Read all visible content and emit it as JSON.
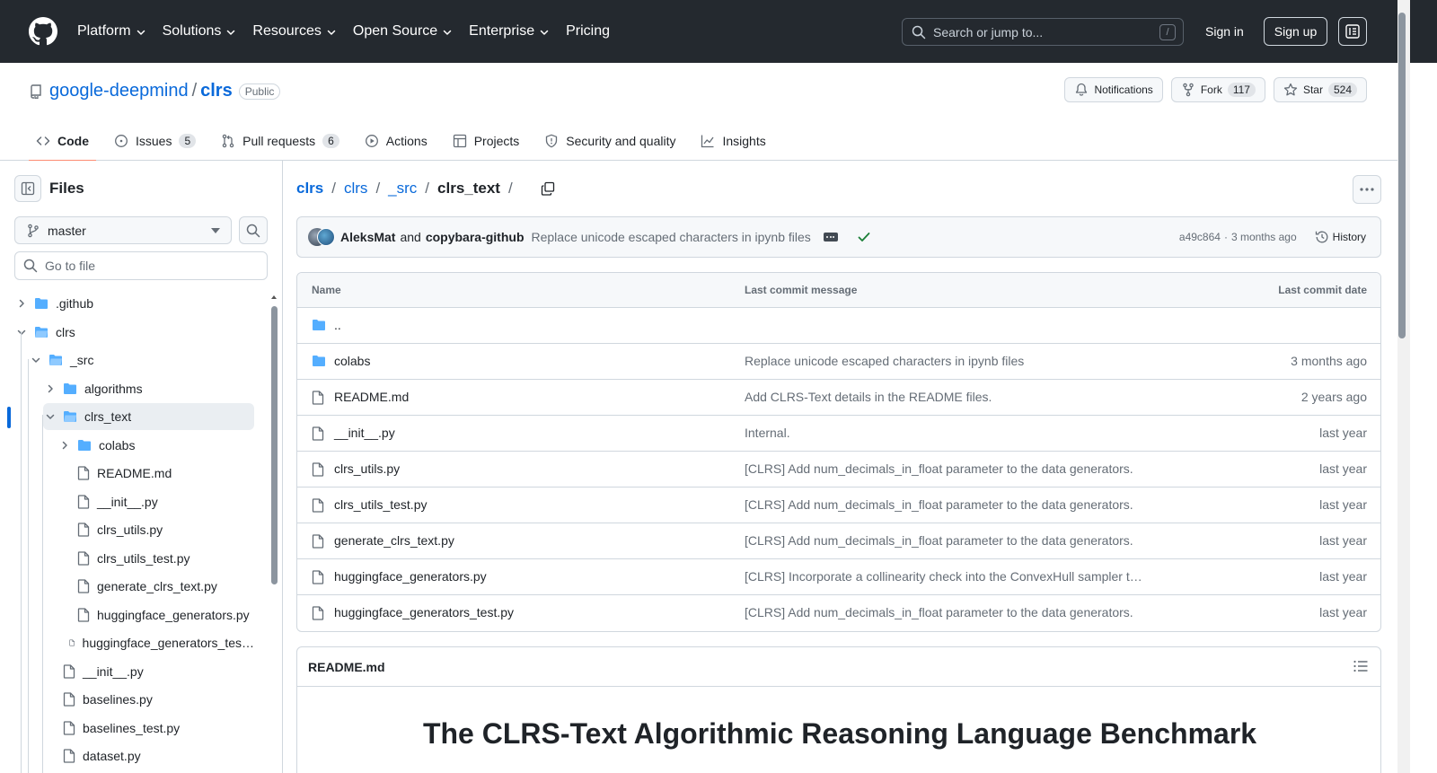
{
  "header": {
    "nav": [
      "Platform",
      "Solutions",
      "Resources",
      "Open Source",
      "Enterprise",
      "Pricing"
    ],
    "nav_has_dropdown": [
      true,
      true,
      true,
      true,
      true,
      false
    ],
    "search_placeholder": "Search or jump to...",
    "search_key": "/",
    "sign_in": "Sign in",
    "sign_up": "Sign up"
  },
  "repo": {
    "owner": "google-deepmind",
    "name": "clrs",
    "visibility": "Public",
    "notifications": "Notifications",
    "fork_label": "Fork",
    "fork_count": "117",
    "star_label": "Star",
    "star_count": "524"
  },
  "tabs": [
    {
      "label": "Code",
      "icon": "code-icon",
      "count": null,
      "active": true
    },
    {
      "label": "Issues",
      "icon": "issue-icon",
      "count": "5",
      "active": false
    },
    {
      "label": "Pull requests",
      "icon": "pull-request-icon",
      "count": "6",
      "active": false
    },
    {
      "label": "Actions",
      "icon": "play-icon",
      "count": null,
      "active": false
    },
    {
      "label": "Projects",
      "icon": "table-icon",
      "count": null,
      "active": false
    },
    {
      "label": "Security and quality",
      "icon": "shield-icon",
      "count": null,
      "active": false
    },
    {
      "label": "Insights",
      "icon": "graph-icon",
      "count": null,
      "active": false
    }
  ],
  "sidebar": {
    "title": "Files",
    "branch": "master",
    "goto_placeholder": "Go to file",
    "tree": [
      {
        "label": ".github",
        "type": "dir",
        "depth": 0,
        "expanded": false
      },
      {
        "label": "clrs",
        "type": "dir",
        "depth": 0,
        "expanded": true
      },
      {
        "label": "_src",
        "type": "dir",
        "depth": 1,
        "expanded": true
      },
      {
        "label": "algorithms",
        "type": "dir",
        "depth": 2,
        "expanded": false
      },
      {
        "label": "clrs_text",
        "type": "dir",
        "depth": 2,
        "expanded": true,
        "selected": true
      },
      {
        "label": "colabs",
        "type": "dir",
        "depth": 3,
        "expanded": false
      },
      {
        "label": "README.md",
        "type": "file",
        "depth": 3
      },
      {
        "label": "__init__.py",
        "type": "file",
        "depth": 3
      },
      {
        "label": "clrs_utils.py",
        "type": "file",
        "depth": 3
      },
      {
        "label": "clrs_utils_test.py",
        "type": "file",
        "depth": 3
      },
      {
        "label": "generate_clrs_text.py",
        "type": "file",
        "depth": 3
      },
      {
        "label": "huggingface_generators.py",
        "type": "file",
        "depth": 3
      },
      {
        "label": "huggingface_generators_tes…",
        "type": "file",
        "depth": 3
      },
      {
        "label": "__init__.py",
        "type": "file",
        "depth": 2
      },
      {
        "label": "baselines.py",
        "type": "file",
        "depth": 2
      },
      {
        "label": "baselines_test.py",
        "type": "file",
        "depth": 2
      },
      {
        "label": "dataset.py",
        "type": "file",
        "depth": 2
      }
    ]
  },
  "breadcrumb": [
    "clrs",
    "clrs",
    "_src",
    "clrs_text"
  ],
  "commit": {
    "author1": "AleksMat",
    "and": "and",
    "author2": "copybara-github",
    "message": "Replace unicode escaped characters in ipynb files",
    "hash": "a49c864",
    "dot": "·",
    "when": "3 months ago",
    "history": "History"
  },
  "files": {
    "headers": {
      "name": "Name",
      "message": "Last commit message",
      "date": "Last commit date"
    },
    "rows": [
      {
        "name": "..",
        "type": "parent",
        "message": "",
        "date": ""
      },
      {
        "name": "colabs",
        "type": "dir",
        "message": "Replace unicode escaped characters in ipynb files",
        "date": "3 months ago"
      },
      {
        "name": "README.md",
        "type": "file",
        "message": "Add CLRS-Text details in the README files.",
        "date": "2 years ago"
      },
      {
        "name": "__init__.py",
        "type": "file",
        "message": "Internal.",
        "date": "last year"
      },
      {
        "name": "clrs_utils.py",
        "type": "file",
        "message": "[CLRS] Add num_decimals_in_float parameter to the data generators.",
        "date": "last year"
      },
      {
        "name": "clrs_utils_test.py",
        "type": "file",
        "message": "[CLRS] Add num_decimals_in_float parameter to the data generators.",
        "date": "last year"
      },
      {
        "name": "generate_clrs_text.py",
        "type": "file",
        "message": "[CLRS] Add num_decimals_in_float parameter to the data generators.",
        "date": "last year"
      },
      {
        "name": "huggingface_generators.py",
        "type": "file",
        "message": "[CLRS] Incorporate a collinearity check into the ConvexHull sampler t…",
        "date": "last year"
      },
      {
        "name": "huggingface_generators_test.py",
        "type": "file",
        "message": "[CLRS] Add num_decimals_in_float parameter to the data generators.",
        "date": "last year"
      }
    ]
  },
  "readme": {
    "title": "README.md",
    "heading": "The CLRS-Text Algorithmic Reasoning Language Benchmark"
  },
  "colors": {
    "header_bg": "#24292f",
    "link": "#0969da",
    "folder": "#54aeff",
    "active_tab_underline": "#fd8c73",
    "success": "#1a7f37"
  }
}
